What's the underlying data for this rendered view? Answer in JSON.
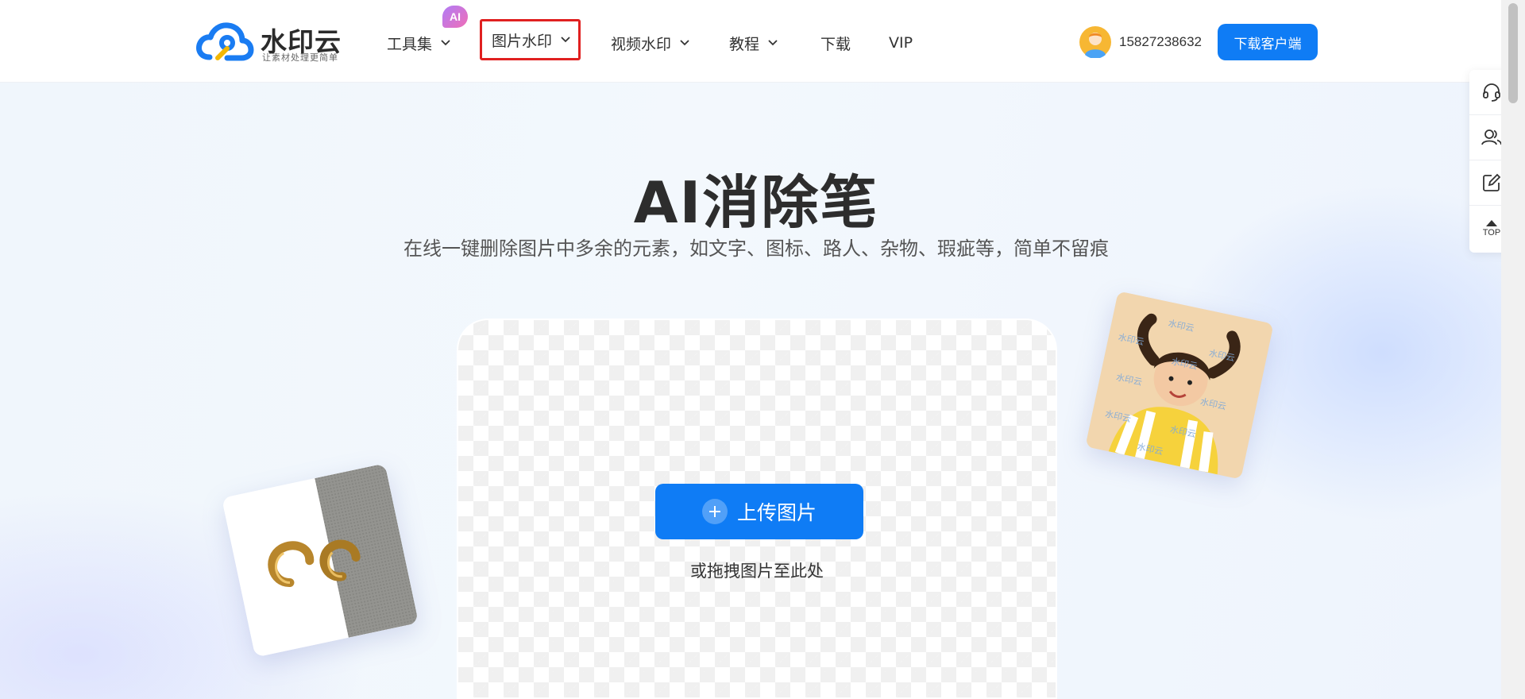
{
  "header": {
    "logo_name": "水印云",
    "logo_slogan": "让素材处理更简单",
    "nav": [
      {
        "label": "工具集",
        "has_dropdown": true,
        "badge": "AI"
      },
      {
        "label": "图片水印",
        "has_dropdown": true,
        "active": true
      },
      {
        "label": "视频水印",
        "has_dropdown": true
      },
      {
        "label": "教程",
        "has_dropdown": true
      },
      {
        "label": "下载",
        "has_dropdown": false
      },
      {
        "label": "VIP",
        "has_dropdown": false
      }
    ],
    "user_phone": "15827238632",
    "download_button": "下载客户端"
  },
  "hero": {
    "title": "AI消除笔",
    "subtitle": "在线一键删除图片中多余的元素，如文字、图标、路人、杂物、瑕疵等，简单不留痕",
    "upload_button": "上传图片",
    "drag_hint": "或拖拽图片至此处",
    "watermark_text": "水印云"
  },
  "side_toolbar": {
    "items": [
      "headset-icon",
      "users-icon",
      "edit-icon",
      "top-icon"
    ],
    "top_label": "TOP"
  },
  "colors": {
    "accent": "#0f7cf5",
    "active_nav_border": "#e02020",
    "ai_badge": "#c474e6"
  }
}
